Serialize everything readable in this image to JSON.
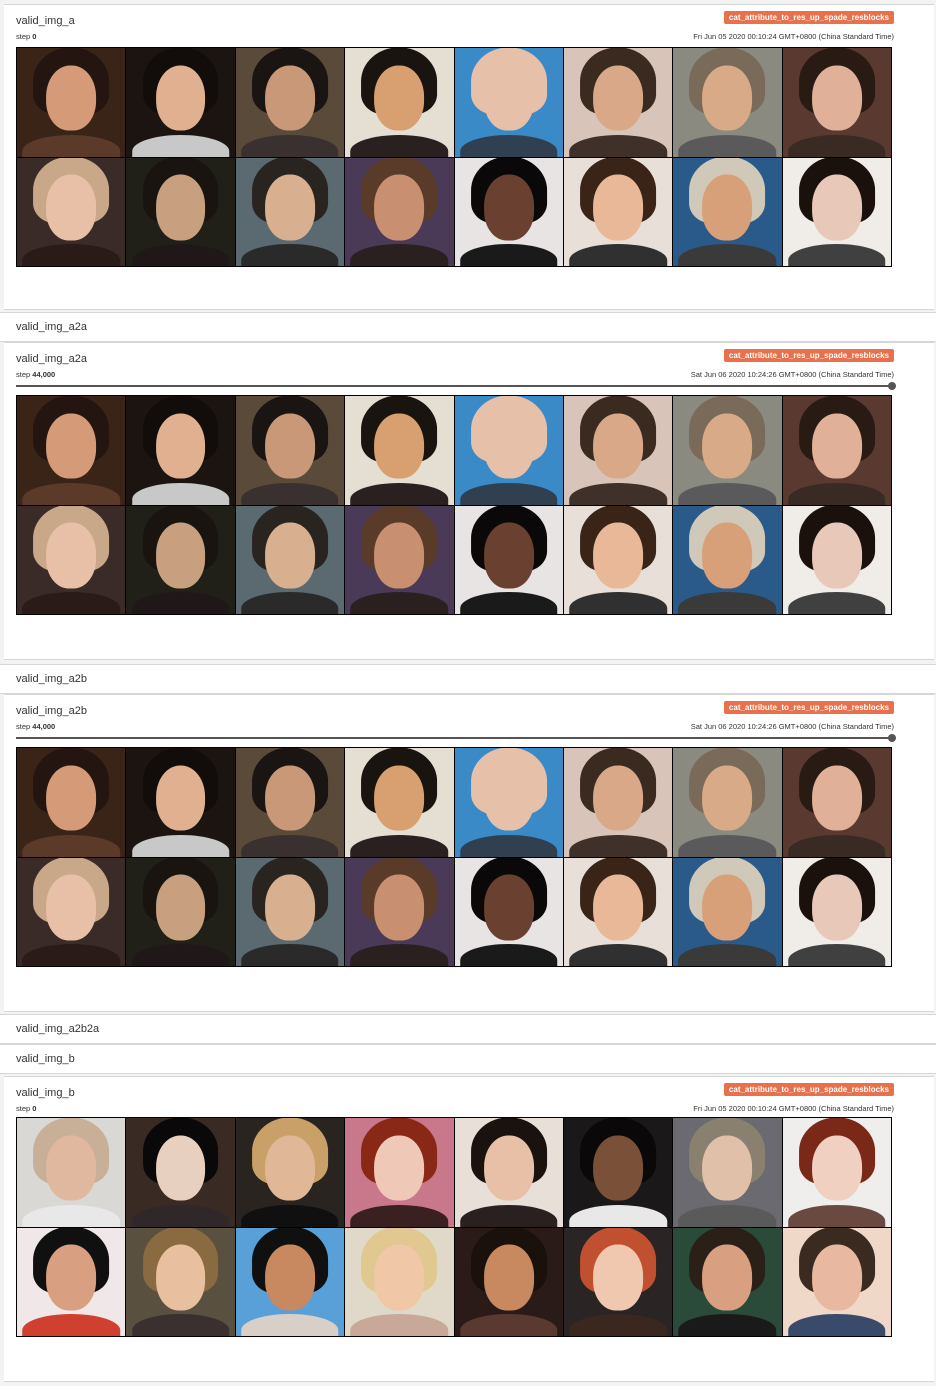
{
  "panel1": {
    "title": "valid_img_a",
    "step_label": "step",
    "step_value": "0",
    "run_tag": "cat_attribute_to_res_up_spade_resblocks",
    "timestamp": "Fri Jun 05 2020 00:10:24 GMT+0800 (China Standard Time)"
  },
  "header_a2a": "valid_img_a2a",
  "panel2": {
    "title": "valid_img_a2a",
    "step_label": "step",
    "step_value": "44,000",
    "run_tag": "cat_attribute_to_res_up_spade_resblocks",
    "timestamp": "Sat Jun 06 2020 10:24:26 GMT+0800 (China Standard Time)"
  },
  "header_a2b": "valid_img_a2b",
  "panel3": {
    "title": "valid_img_a2b",
    "step_label": "step",
    "step_value": "44,000",
    "run_tag": "cat_attribute_to_res_up_spade_resblocks",
    "timestamp": "Sat Jun 06 2020 10:24:26 GMT+0800 (China Standard Time)"
  },
  "header_a2b2a": "valid_img_a2b2a",
  "header_b": "valid_img_b",
  "panel4": {
    "title": "valid_img_b",
    "step_label": "step",
    "step_value": "0",
    "run_tag": "cat_attribute_to_res_up_spade_resblocks",
    "timestamp": "Fri Jun 05 2020 00:10:24 GMT+0800 (China Standard Time)"
  },
  "colors": {
    "tag_bg": "#e8704a",
    "grid_a": [
      [
        "#3a2418",
        "#d59a78",
        "#241510",
        "#5b3a2a"
      ],
      [
        "#1c1410",
        "#e0b090",
        "#120c0a",
        "#c8c8c8"
      ],
      [
        "#5a4a3a",
        "#c89878",
        "#1a1412",
        "#3a3030"
      ],
      [
        "#e4dfd2",
        "#d8a070",
        "#1a1410",
        "#2a2020"
      ],
      [
        "#3a8ac8",
        "#e6c0a8",
        "#e6c0a8",
        "#304050"
      ],
      [
        "#d8c4b8",
        "#d8a888",
        "#3a2a20",
        "#40302a"
      ],
      [
        "#8a8a80",
        "#d8aa88",
        "#7a6a5a",
        "#5a5a5a"
      ],
      [
        "#5a3a30",
        "#e0b098",
        "#2a1a14",
        "#3a2a24"
      ],
      [
        "#3a2a28",
        "#e8c0a8",
        "#c8a888",
        "#2a1a18"
      ],
      [
        "#202018",
        "#c8a080",
        "#1a1410",
        "#201818"
      ],
      [
        "#5a6a70",
        "#d8b090",
        "#2a2420",
        "#2a2a2a"
      ],
      [
        "#4a3a58",
        "#c89070",
        "#5a3a28",
        "#2a2020"
      ],
      [
        "#e8e4e4",
        "#6a4030",
        "#0a0808",
        "#1a1a1a"
      ],
      [
        "#e8e0d8",
        "#e8b898",
        "#3a2418",
        "#303030"
      ],
      [
        "#2a5a8a",
        "#d8a078",
        "#d0c8b8",
        "#3a3a3a"
      ],
      [
        "#f0ece8",
        "#e8c8b8",
        "#1a100c",
        "#404040"
      ]
    ],
    "grid_b": [
      [
        "#dad8d4",
        "#e0b8a0",
        "#c8b098",
        "#e8e8e8"
      ],
      [
        "#3a2a24",
        "#e8d0c0",
        "#0a0808",
        "#302828"
      ],
      [
        "#2a2420",
        "#e0b898",
        "#c8a068",
        "#101010"
      ],
      [
        "#c8788a",
        "#f0c8b8",
        "#8a2818",
        "#3a2020"
      ],
      [
        "#e8e0d8",
        "#e8c0a8",
        "#1a120e",
        "#2a2020"
      ],
      [
        "#1a1818",
        "#7a5038",
        "#0a0808",
        "#e8e8e8"
      ],
      [
        "#6a6a70",
        "#e0c0a8",
        "#8a8070",
        "#5a5a5a"
      ],
      [
        "#f0eeec",
        "#f0d0c0",
        "#7a2818",
        "#6a4a40"
      ],
      [
        "#f0e8e8",
        "#d8a080",
        "#101010",
        "#d04030"
      ],
      [
        "#5a5040",
        "#e8c0a0",
        "#8a6a40",
        "#3a3030"
      ],
      [
        "#5aa0d8",
        "#c88860",
        "#101010",
        "#d8d0c8"
      ],
      [
        "#e0d8c8",
        "#f0c8a8",
        "#e0c890",
        "#c8a898"
      ],
      [
        "#2a1a18",
        "#c88860",
        "#1a100c",
        "#5a3a30"
      ],
      [
        "#2a2424",
        "#f0c8b0",
        "#c05030",
        "#3a2820"
      ],
      [
        "#2a4a3a",
        "#d8a080",
        "#2a2018",
        "#1a1a1a"
      ],
      [
        "#f0d8c8",
        "#e8b8a0",
        "#3a2a20",
        "#3a4a6a"
      ]
    ]
  }
}
